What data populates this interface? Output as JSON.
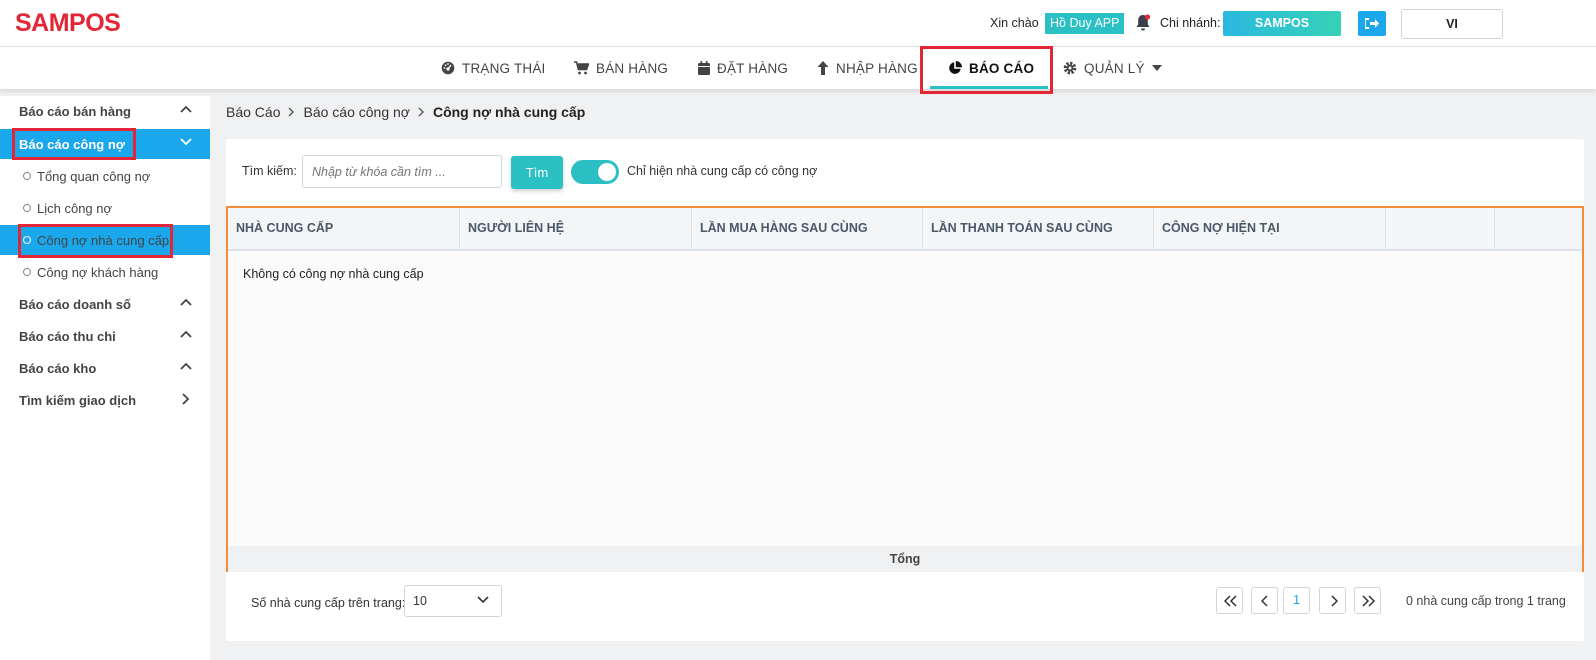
{
  "brand": {
    "logo": "SAMPOS",
    "accent": "#e32636",
    "teal": "#2bc0c3",
    "blue": "#1aa7ec"
  },
  "header": {
    "greeting": "Xin chào",
    "user": "Hồ Duy APP",
    "branch_label": "Chi nhánh:",
    "branch": "SAMPOS",
    "language": "VI",
    "icons": [
      "bell-icon",
      "logout-icon"
    ]
  },
  "nav": {
    "items": [
      {
        "label": "TRẠNG THÁI",
        "icon": "dashboard-icon"
      },
      {
        "label": "BÁN HÀNG",
        "icon": "cart-icon"
      },
      {
        "label": "ĐẶT HÀNG",
        "icon": "calendar-icon"
      },
      {
        "label": "NHẬP HÀNG",
        "icon": "arrow-up-icon"
      },
      {
        "label": "BÁO CÁO",
        "icon": "pie-chart-icon",
        "active": true
      },
      {
        "label": "QUẢN LÝ",
        "icon": "gear-icon"
      }
    ]
  },
  "sidebar": {
    "groups": [
      {
        "label": "Báo cáo bán hàng"
      },
      {
        "label": "Báo cáo công nợ",
        "active": true,
        "children": [
          "Tổng quan công nợ",
          "Lịch công nợ",
          "Công nợ nhà cung cấp",
          "Công nợ khách hàng"
        ],
        "active_child": 2
      },
      {
        "label": "Báo cáo doanh số"
      },
      {
        "label": "Báo cáo thu chi"
      },
      {
        "label": "Báo cáo kho"
      },
      {
        "label": "Tìm kiếm giao dịch"
      }
    ]
  },
  "breadcrumb": [
    "Báo Cáo",
    "Báo cáo công nợ",
    "Công nợ nhà cung cấp"
  ],
  "filter": {
    "search_label": "Tìm kiếm:",
    "search_placeholder": "Nhập từ khóa cần tìm ...",
    "search_button": "Tìm",
    "toggle_on": true,
    "toggle_label": "Chỉ hiện nhà cung cấp có công nợ"
  },
  "table": {
    "columns": [
      "NHÀ CUNG CẤP",
      "NGƯỜI LIÊN HỆ",
      "LẦN MUA HÀNG SAU CÙNG",
      "LẦN THANH TOÁN SAU CÙNG",
      "CÔNG NỢ HIỆN TẠI",
      "",
      ""
    ],
    "empty_message": "Không có công nợ nhà cung cấp",
    "footer_label": "Tổng"
  },
  "pagination": {
    "page_size_label": "Số nhà cung cấp trên trang:",
    "page_size": "10",
    "current_page": "1",
    "info": "0 nhà cung cấp trong 1 trang"
  }
}
